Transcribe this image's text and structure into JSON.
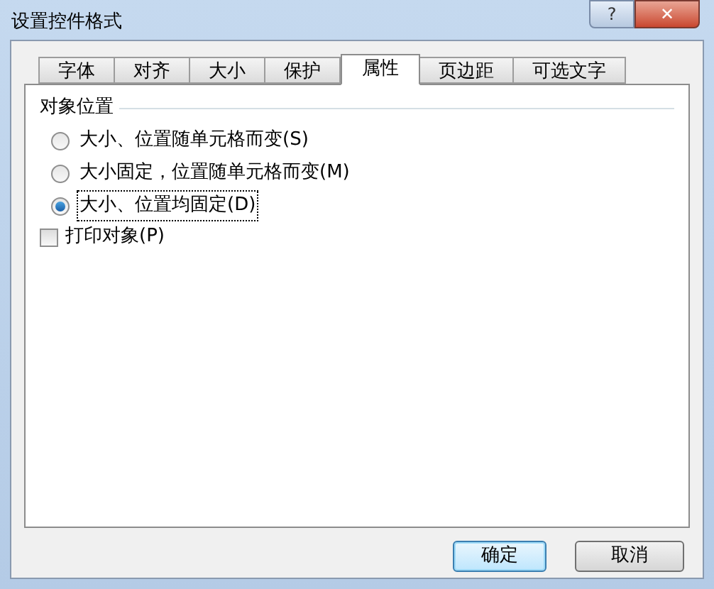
{
  "window": {
    "title": "设置控件格式",
    "help": "?",
    "close": "✕"
  },
  "tabs": [
    {
      "label": "字体",
      "selected": false
    },
    {
      "label": "对齐",
      "selected": false
    },
    {
      "label": "大小",
      "selected": false
    },
    {
      "label": "保护",
      "selected": false
    },
    {
      "label": "属性",
      "selected": true
    },
    {
      "label": "页边距",
      "selected": false
    },
    {
      "label": "可选文字",
      "selected": false
    }
  ],
  "group": {
    "title": "对象位置",
    "options": [
      {
        "label": "大小、位置随单元格而变(S)",
        "selected": false,
        "focused": false
      },
      {
        "label": "大小固定，位置随单元格而变(M)",
        "selected": false,
        "focused": false
      },
      {
        "label": "大小、位置均固定(D)",
        "selected": true,
        "focused": true
      }
    ]
  },
  "print_object": {
    "label": "打印对象(P)",
    "checked": false
  },
  "buttons": [
    {
      "label": "确定",
      "default": true
    },
    {
      "label": "取消",
      "default": false
    }
  ]
}
